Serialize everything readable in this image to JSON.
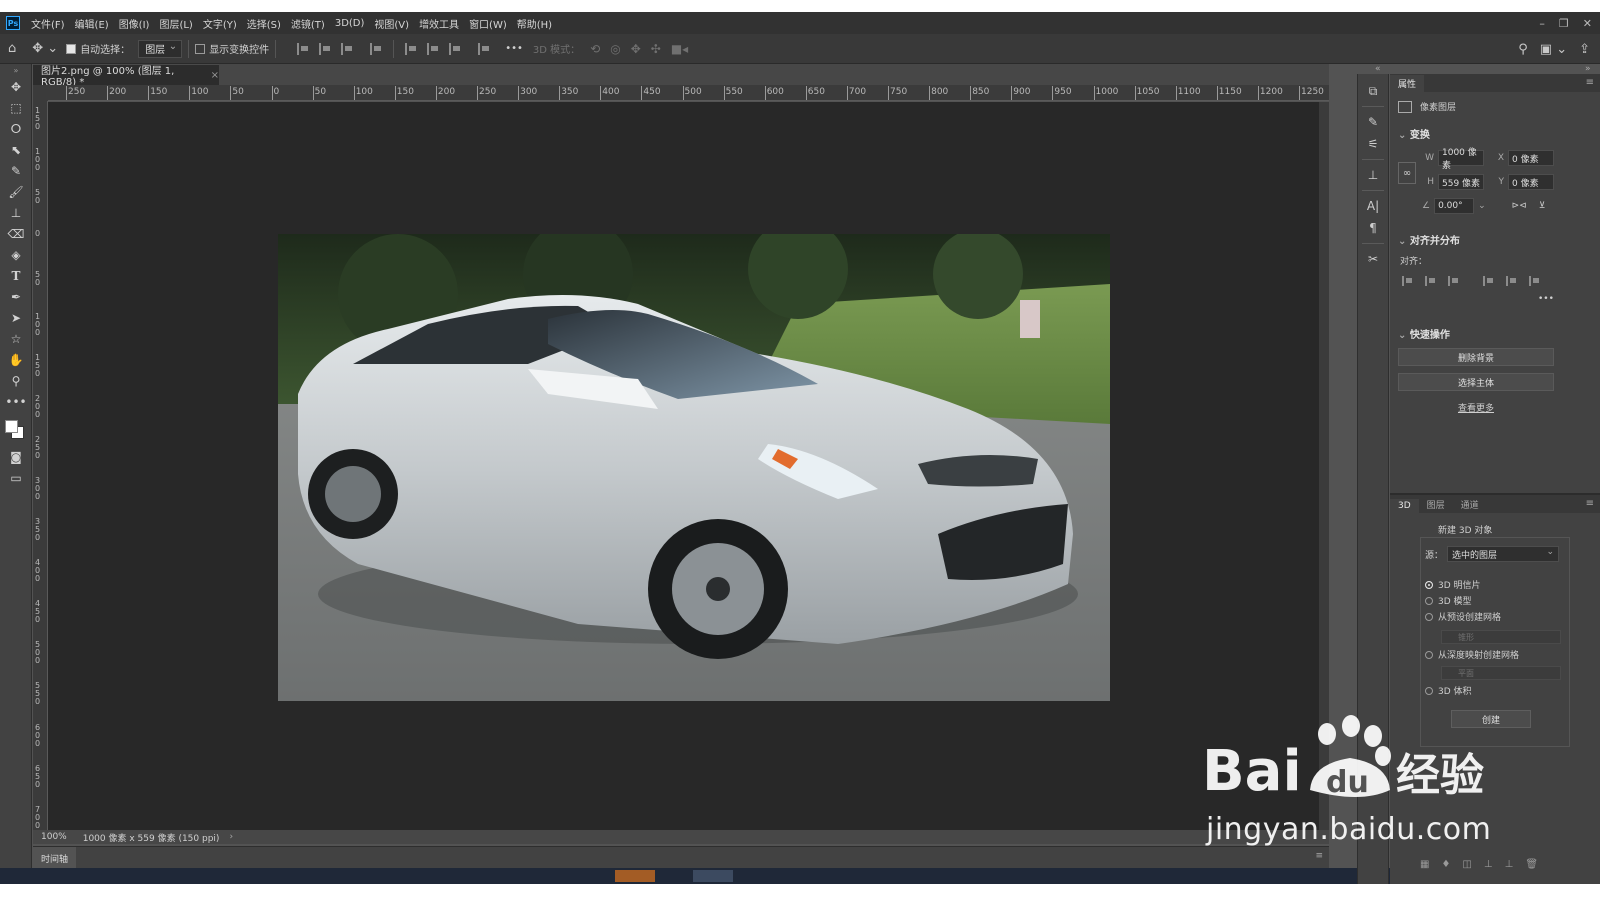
{
  "app": {
    "logo": "Ps",
    "menu": [
      "文件(F)",
      "编辑(E)",
      "图像(I)",
      "图层(L)",
      "文字(Y)",
      "选择(S)",
      "滤镜(T)",
      "3D(D)",
      "视图(V)",
      "增效工具",
      "窗口(W)",
      "帮助(H)"
    ],
    "window_controls": [
      "–",
      "❐",
      "✕"
    ]
  },
  "options_bar": {
    "auto_select_label": "自动选择：",
    "auto_select_checked": true,
    "auto_select_target": "图层",
    "show_transform_label": "显示变换控件",
    "show_transform_checked": false,
    "more_label": "•••",
    "mode_3d_label": "3D 模式："
  },
  "document": {
    "tab_title": "图片2.png @ 100% (图层 1, RGB/8) *",
    "zoom": "100%",
    "dimensions": "1000 像素 x 559 像素 (150 ppi)"
  },
  "rulers": {
    "top": [
      "250",
      "200",
      "150",
      "100",
      "50",
      "0",
      "50",
      "100",
      "150",
      "200",
      "250",
      "300",
      "350",
      "400",
      "450",
      "500",
      "550",
      "600",
      "650",
      "700",
      "750",
      "800",
      "850",
      "900",
      "950",
      "1000",
      "1050",
      "1100",
      "1150",
      "1200",
      "1250"
    ],
    "left": [
      "150",
      "100",
      "50",
      "0",
      "50",
      "100",
      "150",
      "200",
      "250",
      "300",
      "350",
      "400",
      "450",
      "500",
      "550",
      "600",
      "650",
      "700"
    ]
  },
  "properties_panel": {
    "tab": "属性",
    "layer_type": "像素图层",
    "transform": {
      "title": "变换",
      "w_label": "W",
      "w_value": "1000 像素",
      "x_label": "X",
      "x_value": "0 像素",
      "h_label": "H",
      "h_value": "559 像素",
      "y_label": "Y",
      "y_value": "0 像素",
      "angle": "0.00°"
    },
    "align": {
      "title": "对齐并分布",
      "label": "对齐："
    },
    "quick_actions": {
      "title": "快速操作",
      "remove_bg": "删除背景",
      "select_subject": "选择主体",
      "see_more": "查看更多"
    }
  },
  "panel_3d": {
    "tabs": [
      "3D",
      "图层",
      "通道"
    ],
    "title": "新建 3D 对象",
    "source_label": "源：",
    "source_value": "选中的图层",
    "options": [
      "3D 明信片",
      "3D 模型",
      "从预设创建网格",
      "从深度映射创建网格",
      "3D 体积"
    ],
    "selected_option": "3D 明信片",
    "preset_placeholder": "锥形",
    "depth_placeholder": "平面",
    "create_button": "创建"
  },
  "timeline": {
    "tab": "时间轴"
  },
  "watermark": {
    "brand": "Bai",
    "brand_suffix": "经验",
    "url": "jingyan.baidu.com"
  },
  "colors": {
    "accent": "#31a8ff",
    "panel": "#424242",
    "canvas": "#282828",
    "foreground_swatch": "#ffffff",
    "background_swatch": "#ffffff"
  },
  "icons": {
    "toolbar": [
      "move-icon",
      "marquee-icon",
      "lasso-icon",
      "object-select-icon",
      "eyedropper-icon",
      "brush-icon",
      "stamp-icon",
      "eraser-icon",
      "bucket-icon",
      "type-icon",
      "pen-icon",
      "path-select-icon",
      "shape-icon",
      "hand-icon",
      "zoom-icon",
      "more-tools-icon"
    ],
    "middle_strip": [
      "history-icon",
      "brush-settings-icon",
      "adjust-icon",
      "clone-source-icon",
      "character-icon",
      "paragraph-icon",
      "tools-icon"
    ]
  }
}
